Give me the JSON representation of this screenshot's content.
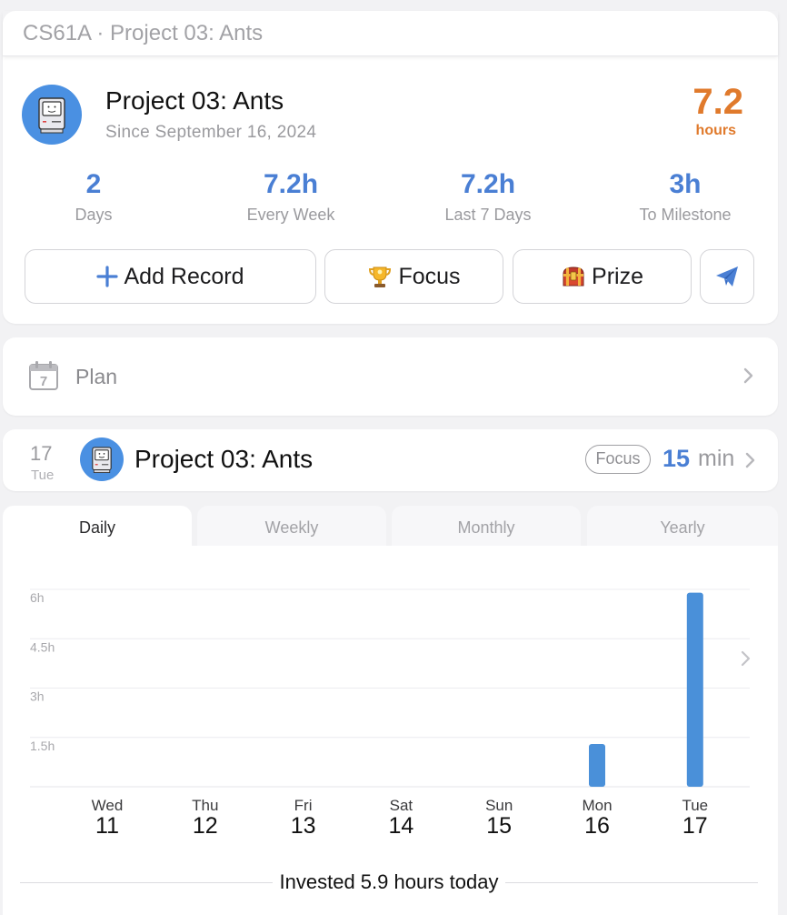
{
  "window": {
    "title": "CS61A · Project 03: Ants"
  },
  "project": {
    "name": "Project 03: Ants",
    "since": "Since September 16, 2024",
    "total_value": "7.2",
    "total_unit": "hours",
    "avatar_icon": "classic-mac-icon"
  },
  "stats": [
    {
      "value": "2",
      "label": "Days"
    },
    {
      "value": "7.2h",
      "label": "Every Week"
    },
    {
      "value": "7.2h",
      "label": "Last 7 Days"
    },
    {
      "value": "3h",
      "label": "To Milestone"
    }
  ],
  "actions": {
    "add_record": "Add Record",
    "focus": "Focus",
    "prize": "Prize",
    "share_icon": "paper-plane-icon"
  },
  "plan": {
    "label": "Plan",
    "icon": "calendar-icon",
    "calendar_day": "7"
  },
  "record": {
    "day": "17",
    "weekday": "Tue",
    "name": "Project 03: Ants",
    "tag": "Focus",
    "minutes": "15",
    "unit": "min"
  },
  "tabs": [
    "Daily",
    "Weekly",
    "Monthly",
    "Yearly"
  ],
  "active_tab": "Daily",
  "chart_data": {
    "type": "bar",
    "categories": [
      "Wed 11",
      "Thu 12",
      "Fri 13",
      "Sat 14",
      "Sun 15",
      "Mon 16",
      "Tue 17"
    ],
    "weekdays": [
      "Wed",
      "Thu",
      "Fri",
      "Sat",
      "Sun",
      "Mon",
      "Tue"
    ],
    "days": [
      "11",
      "12",
      "13",
      "14",
      "15",
      "16",
      "17"
    ],
    "values": [
      0,
      0,
      0,
      0,
      0,
      1.3,
      5.9
    ],
    "yticks": [
      "6h",
      "4.5h",
      "3h",
      "1.5h"
    ],
    "ytick_values": [
      6,
      4.5,
      3,
      1.5
    ],
    "ylim": [
      0,
      6
    ],
    "bar_color": "#4a90d9",
    "grid": true
  },
  "footer": {
    "text": "Invested 5.9 hours today"
  },
  "colors": {
    "accent": "#4a7fd4",
    "orange": "#e07a2c"
  }
}
